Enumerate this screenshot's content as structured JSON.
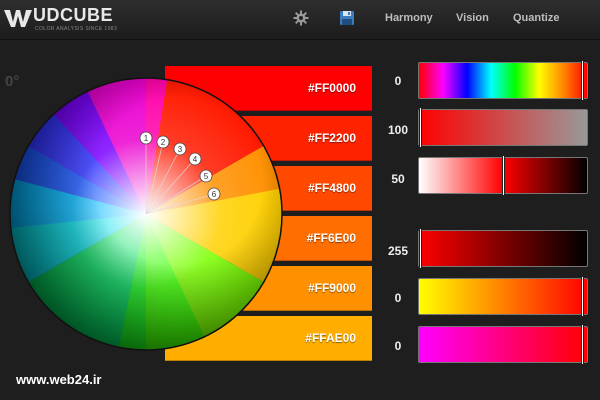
{
  "app": {
    "logo_name": "UDCUBE",
    "logo_tagline": "COLOR ANALYSIS SINCE 1983"
  },
  "toolbar": {
    "gear_icon": "gear-icon",
    "save_icon": "save-icon",
    "nav": [
      "Harmony",
      "Vision",
      "Quantize"
    ]
  },
  "wheel": {
    "angle_label": "0°",
    "markers": [
      "1",
      "2",
      "3",
      "4",
      "5",
      "6"
    ]
  },
  "swatches": [
    {
      "hex": "#FF0000",
      "color": "#FF0000"
    },
    {
      "hex": "#FF2200",
      "color": "#FF2200"
    },
    {
      "hex": "#FF4800",
      "color": "#FF4800"
    },
    {
      "hex": "#FF6E00",
      "color": "#FF6E00"
    },
    {
      "hex": "#FF9000",
      "color": "#FF9000"
    },
    {
      "hex": "#FFAE00",
      "color": "#FFAE00"
    }
  ],
  "sliders": [
    {
      "value": "0",
      "level": 0.98
    },
    {
      "value": "100",
      "level": 0.0
    },
    {
      "value": "50",
      "level": 0.5
    },
    {
      "value": "255",
      "level": 0.0
    },
    {
      "value": "0",
      "level": 0.98
    },
    {
      "value": "0",
      "level": 0.98
    }
  ],
  "watermark": "www.web24.ir"
}
